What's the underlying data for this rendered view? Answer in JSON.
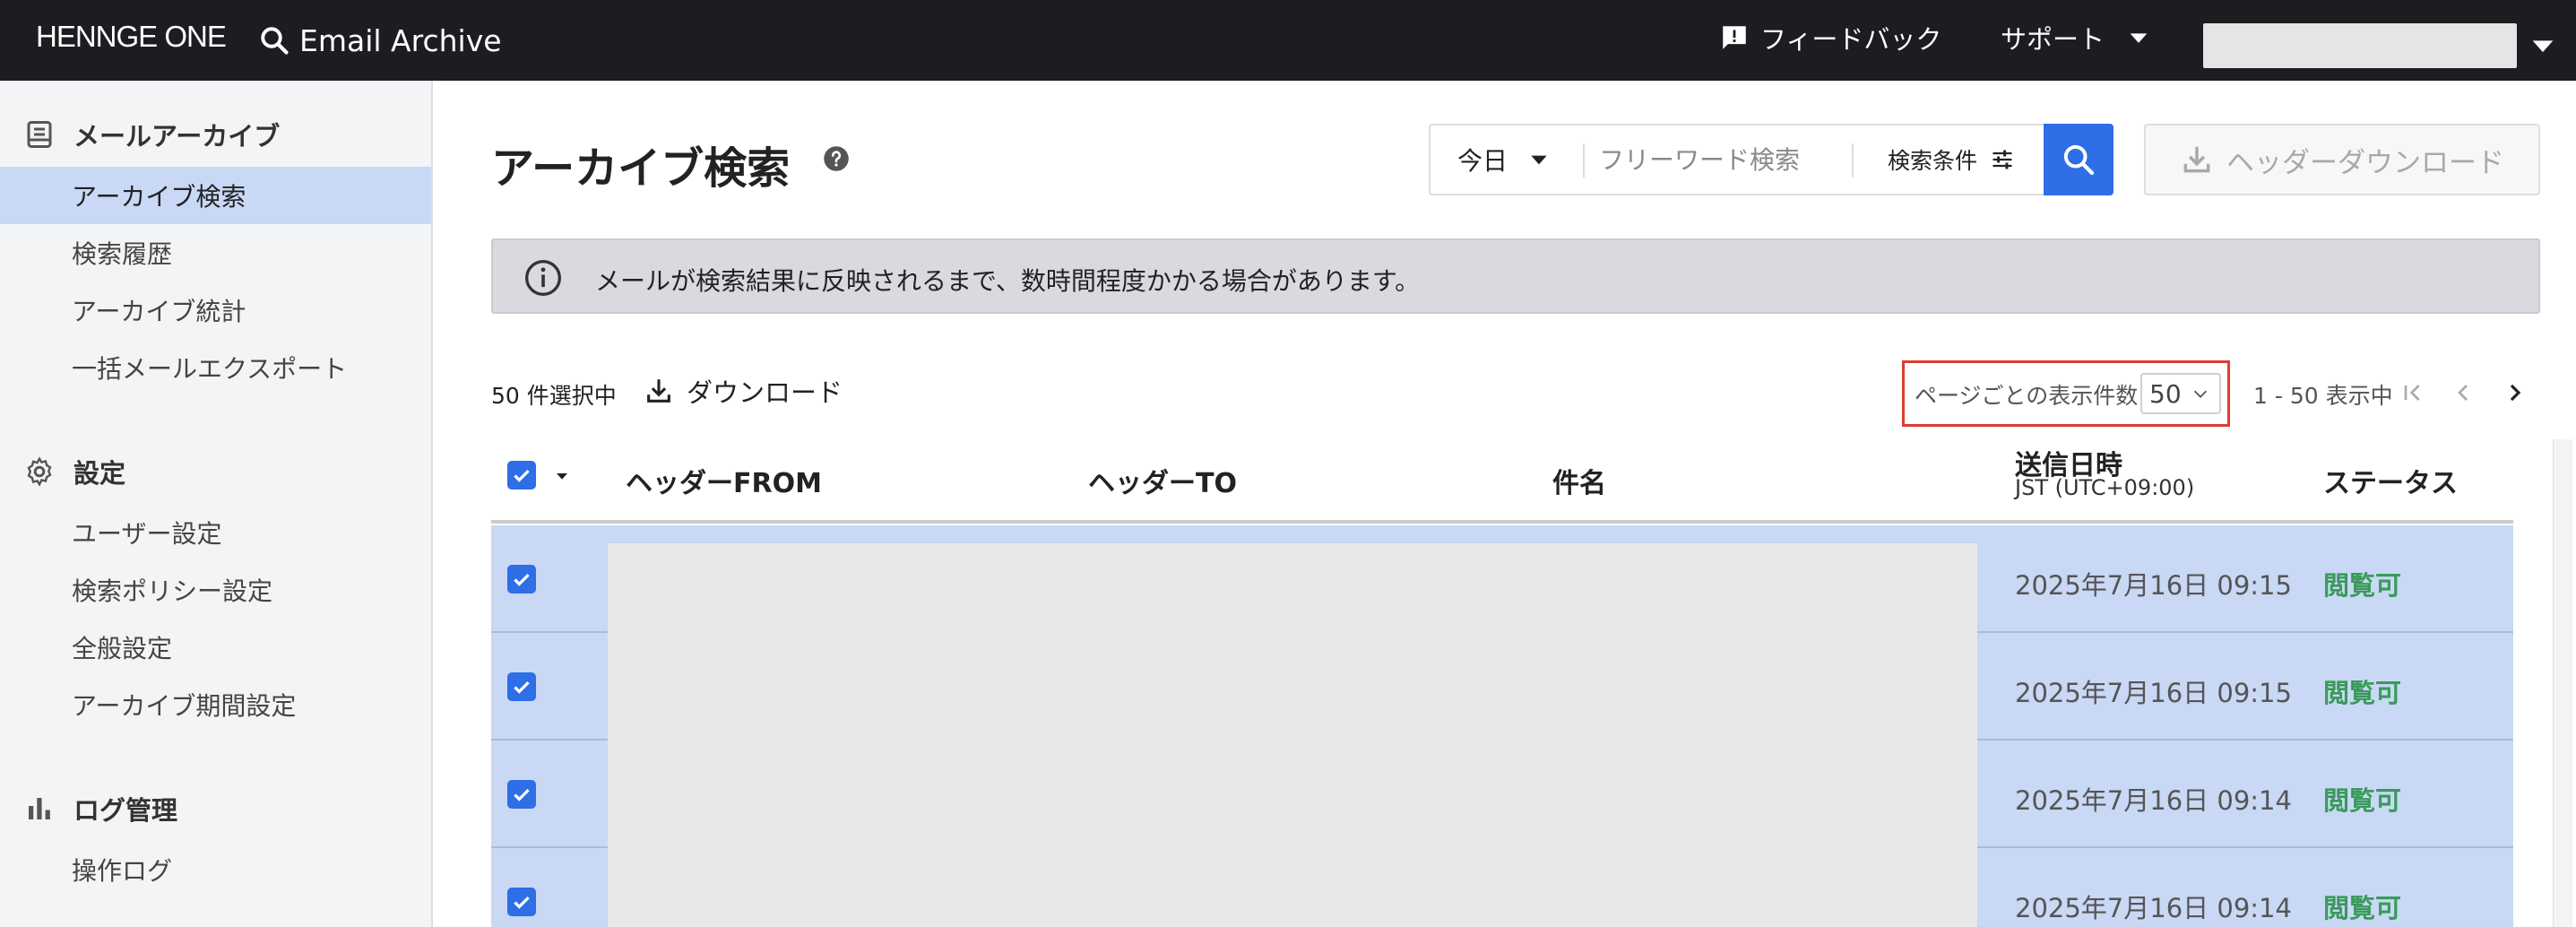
{
  "topbar": {
    "brand": "HENNGE ONE",
    "app_title": "Email Archive",
    "feedback_label": "フィードバック",
    "support_label": "サポート"
  },
  "sidebar": {
    "sections": [
      {
        "title": "メールアーカイブ",
        "icon": "archive-icon",
        "items": [
          "アーカイブ検索",
          "検索履歴",
          "アーカイブ統計",
          "一括メールエクスポート"
        ]
      },
      {
        "title": "設定",
        "icon": "gear-icon",
        "items": [
          "ユーザー設定",
          "検索ポリシー設定",
          "全般設定",
          "アーカイブ期間設定"
        ]
      },
      {
        "title": "ログ管理",
        "icon": "bar-chart-icon",
        "items": [
          "操作ログ"
        ]
      }
    ],
    "active_item": "アーカイブ検索"
  },
  "main": {
    "title": "アーカイブ検索",
    "search": {
      "date_value": "今日",
      "keyword_placeholder": "フリーワード検索",
      "conditions_label": "検索条件"
    },
    "header_download_label": "ヘッダーダウンロード",
    "notice": "メールが検索結果に反映されるまで、数時間程度かかる場合があります。",
    "selection_count": "50 件選択中",
    "download_label": "ダウンロード",
    "per_page_label": "ページごとの表示件数",
    "per_page_value": "50",
    "range_text": "1 - 50 表示中"
  },
  "table": {
    "columns": {
      "from": "ヘッダーFROM",
      "to": "ヘッダーTO",
      "subject": "件名",
      "sent": "送信日時",
      "sent_sub": "JST (UTC+09:00)",
      "status": "ステータス"
    },
    "rows": [
      {
        "sent": "2025年7月16日 09:15",
        "status": "閲覧可"
      },
      {
        "sent": "2025年7月16日 09:15",
        "status": "閲覧可"
      },
      {
        "sent": "2025年7月16日 09:14",
        "status": "閲覧可"
      },
      {
        "sent": "2025年7月16日 09:14",
        "status": "閲覧可"
      }
    ]
  },
  "colors": {
    "topbar": "#1c1d20",
    "accent": "#2e6ee6",
    "selected_row": "#c8d8f5",
    "status_ok": "#3a9a5a",
    "highlight_border": "#e03c31"
  }
}
